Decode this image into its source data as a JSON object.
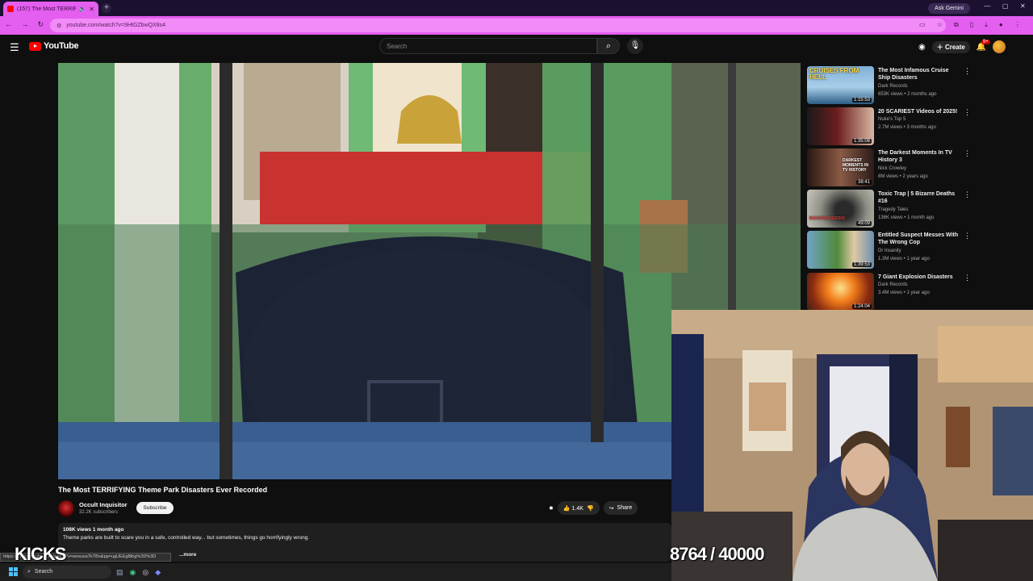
{
  "browser": {
    "tab_title": "(157) The Most TERRIFYI...",
    "url": "youtube.com/watch?v=9HtGZbwQX8s4",
    "ask_gemini": "Ask Gemini",
    "new_tab": "+"
  },
  "youtube": {
    "logo_text": "YouTube",
    "search_placeholder": "Search",
    "create_label": "Create",
    "notif_count": "9+"
  },
  "video": {
    "title": "The Most TERRIFYING Theme Park Disasters Ever Recorded",
    "channel_name": "Occult Inquisitor",
    "subscribers": "32.2K subscribers",
    "subscribe_label": "Subscribe",
    "likes": "1.4K",
    "share_label": "Share",
    "meta": "108K views  1 month ago",
    "description": "Theme parks are built to scare you in a safe, controlled way... but sometimes, things go horrifyingly wrong.",
    "more_label": "...more",
    "status_url": "https://www.youtube.com/watch?v=woxuvaTkTBo&pp=ugUEEgBlbg%3D%3D"
  },
  "recommendations": [
    {
      "title": "The Most Infamous Cruise Ship Disasters",
      "channel": "Dark Records",
      "meta": "653K views • 2 months ago",
      "duration": "1:15:53",
      "thumb_text": "CRUISES FROM HELL"
    },
    {
      "title": "20 SCARIEST Videos of 2025!",
      "channel": "Nuke's Top 5",
      "meta": "2.7M views • 3 months ago",
      "duration": "1:35:08",
      "thumb_text": ""
    },
    {
      "title": "The Darkest Moments In TV History 3",
      "channel": "Nick Crowley",
      "meta": "8M views • 2 years ago",
      "duration": "38:41",
      "thumb_text": "DARKEST MOMENTS IN TV HISTORY"
    },
    {
      "title": "Toxic Trap | 5 Bizarre Deaths #16",
      "channel": "Tragedy Tales",
      "meta": "136K views • 1 month ago",
      "duration": "49:09",
      "thumb_text": "BIZARRE DEATHS"
    },
    {
      "title": "Entitled Suspect Messes With The Wrong Cop",
      "channel": "Dr Insanity",
      "meta": "1.3M views • 1 year ago",
      "duration": "1:39:53",
      "thumb_text": ""
    },
    {
      "title": "7 Giant Explosion Disasters",
      "channel": "Dark Records",
      "meta": "3.4M views • 1 year ago",
      "duration": "1:24:04",
      "thumb_text": ""
    }
  ],
  "overlay": {
    "kicks_label": "KICKS",
    "counter": "8764 / 40000"
  },
  "taskbar": {
    "search_label": "Search"
  },
  "colors": {
    "accent_browser": "#e45ef0",
    "yt_red": "#ff0000",
    "background": "#0f0f0f"
  }
}
